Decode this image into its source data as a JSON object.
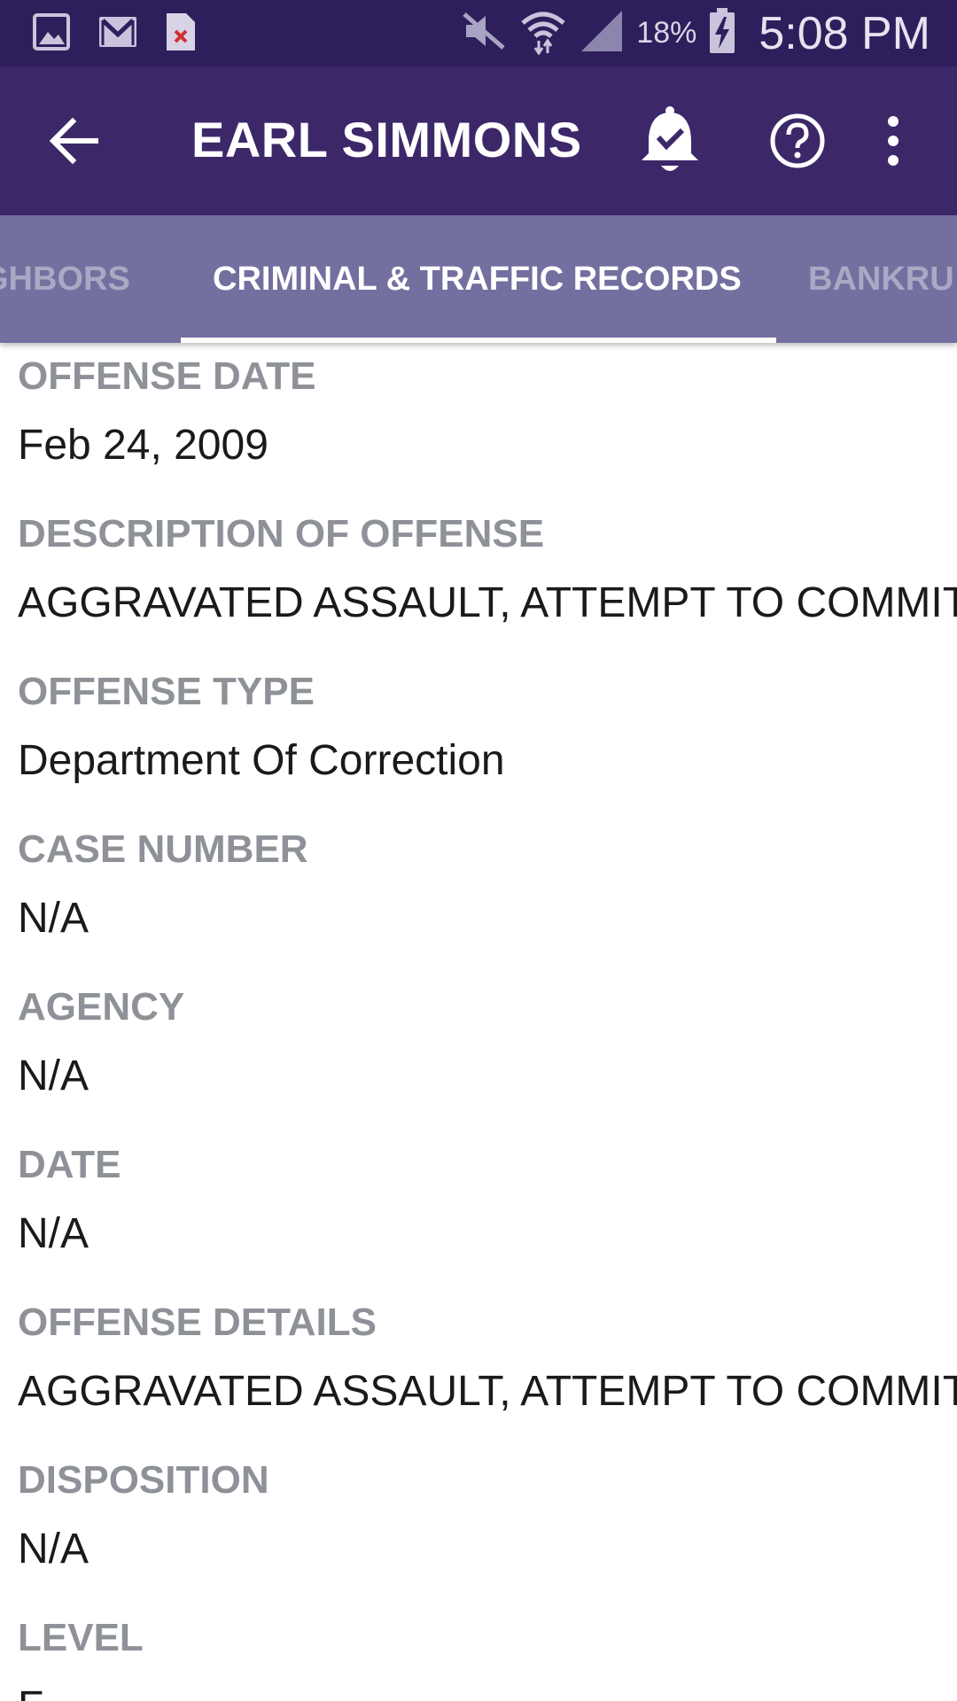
{
  "status_bar": {
    "left_icons": [
      "gallery-icon",
      "gmail-icon",
      "file-error-icon"
    ],
    "right_icons": [
      "mute-icon",
      "wifi-icon",
      "signal-icon",
      "battery-charging-icon"
    ],
    "battery_percent": "18%",
    "time": "5:08 PM"
  },
  "app_bar": {
    "title": "EARL SIMMONS",
    "icons": [
      "back-arrow-icon",
      "bell-check-icon",
      "help-icon",
      "more-vert-icon"
    ]
  },
  "tabs": {
    "items": [
      {
        "label": "GHBORS",
        "selected": false
      },
      {
        "label": "CRIMINAL & TRAFFIC RECORDS",
        "selected": true
      },
      {
        "label": "BANKRU",
        "selected": false
      }
    ]
  },
  "colors": {
    "status_bar_bg": "#2e1f5c",
    "app_bar_bg": "#3c2869",
    "tabs_bg": "#736f9f",
    "label_color": "#8e9298",
    "value_color": "#1a1a1a"
  },
  "record": {
    "fields": [
      {
        "label": "OFFENSE DATE",
        "value": "Feb 24, 2009"
      },
      {
        "label": "DESCRIPTION OF OFFENSE",
        "value": "AGGRAVATED ASSAULT, ATTEMPT TO COMMIT"
      },
      {
        "label": "OFFENSE TYPE",
        "value": "Department Of Correction"
      },
      {
        "label": "CASE NUMBER",
        "value": "N/A"
      },
      {
        "label": "AGENCY",
        "value": "N/A"
      },
      {
        "label": "DATE",
        "value": "N/A"
      },
      {
        "label": "OFFENSE DETAILS",
        "value": "AGGRAVATED ASSAULT, ATTEMPT TO COMMIT"
      },
      {
        "label": "DISPOSITION",
        "value": "N/A"
      },
      {
        "label": "LEVEL",
        "value": "F"
      }
    ]
  }
}
